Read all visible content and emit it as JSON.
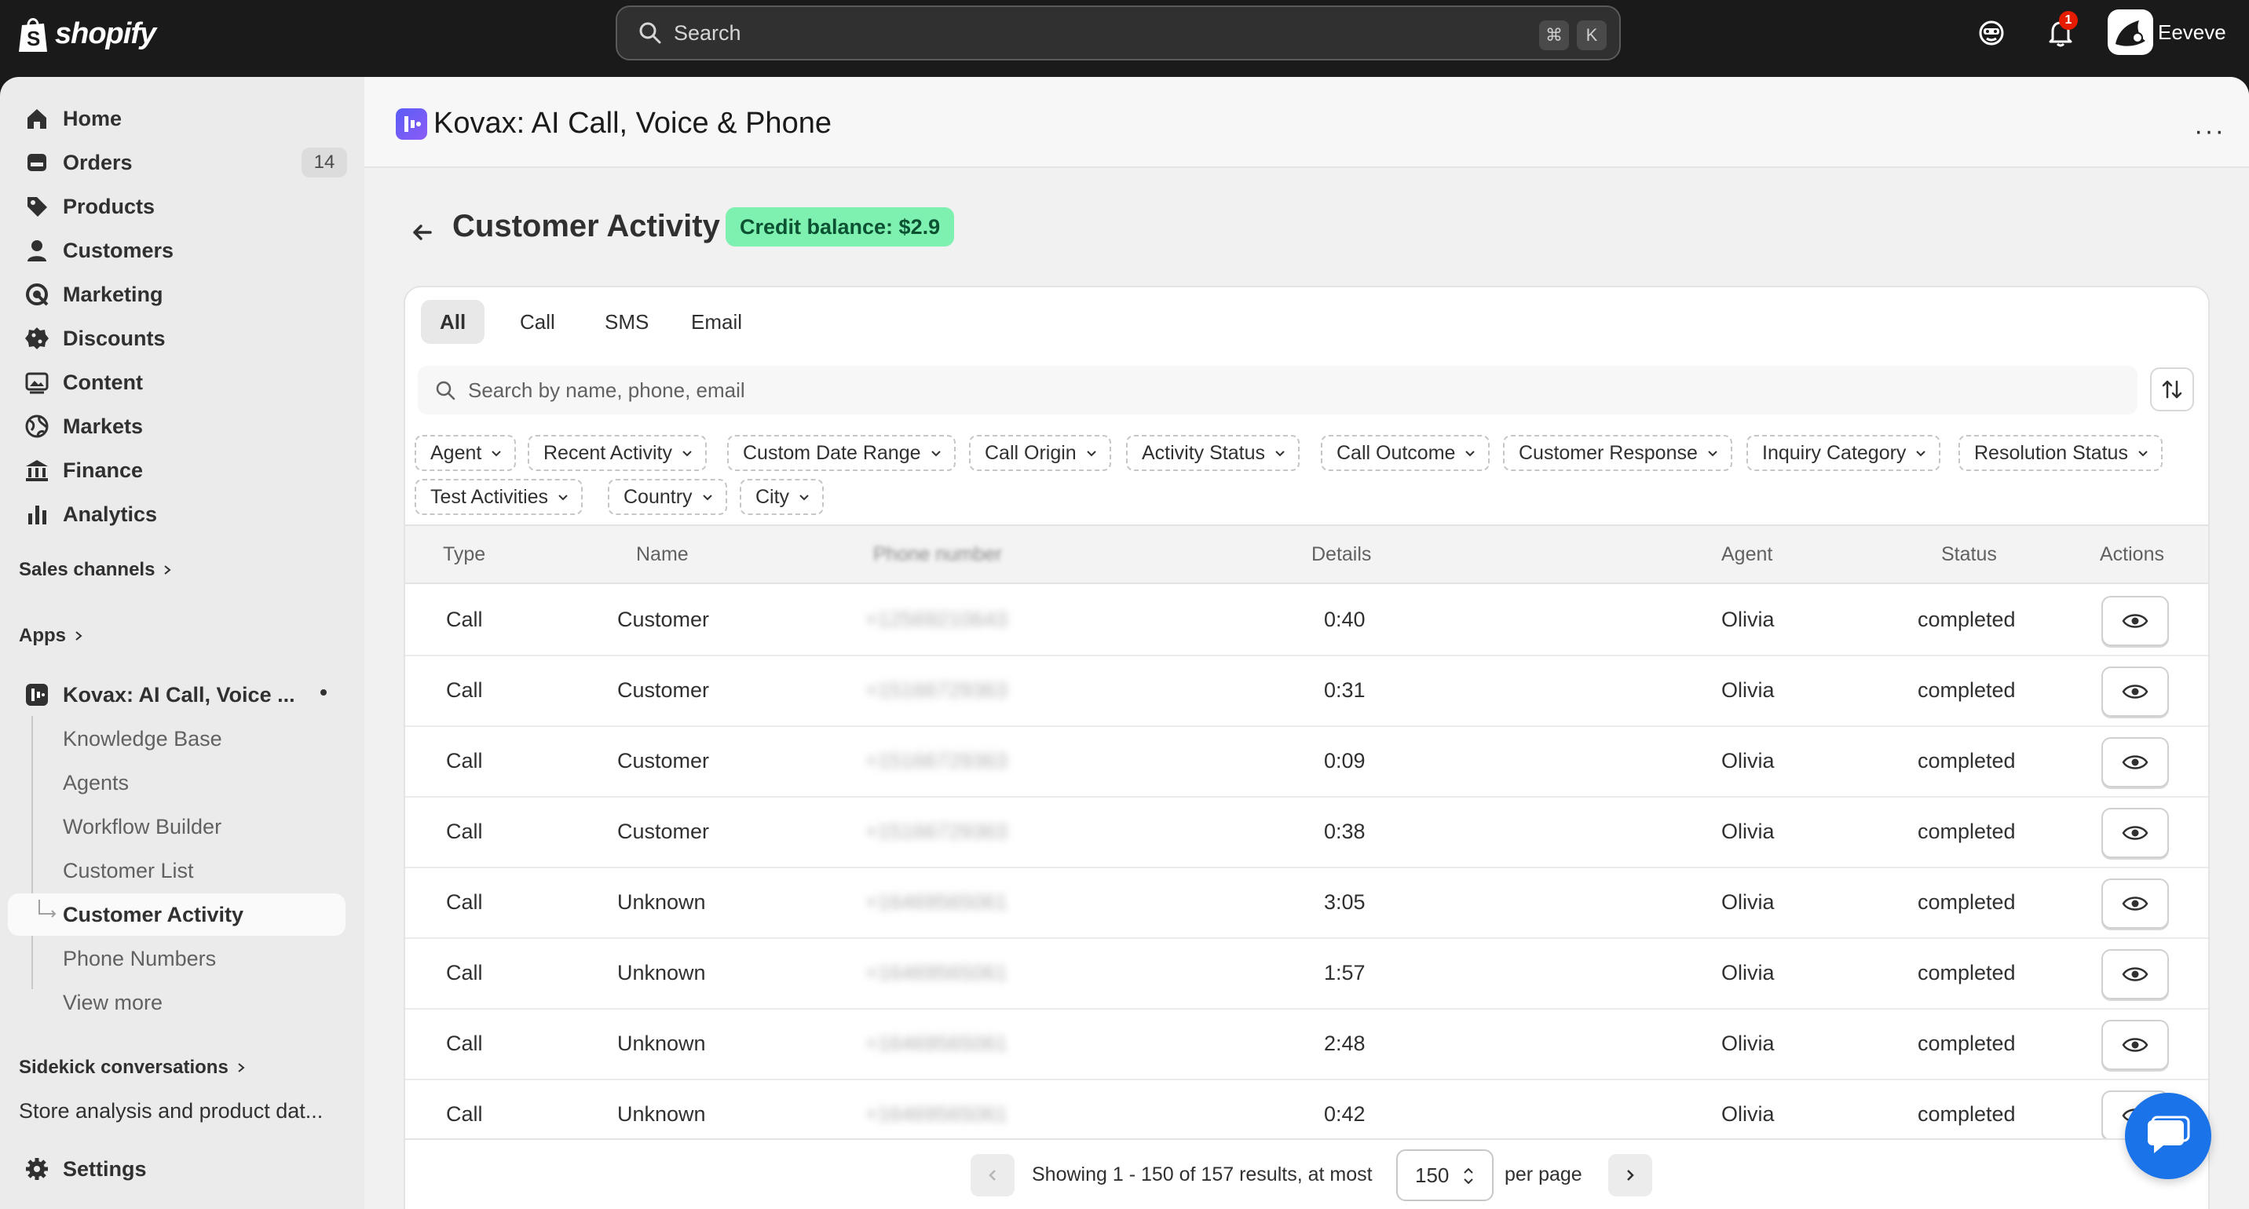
{
  "topbar": {
    "brand": "shopify",
    "search_placeholder": "Search",
    "kbd_cmd": "⌘",
    "kbd_k": "K",
    "notification_count": "1",
    "user_name": "Eeveve"
  },
  "sidebar": {
    "items": [
      {
        "label": "Home",
        "icon": "home-icon"
      },
      {
        "label": "Orders",
        "icon": "orders-icon",
        "count": "14"
      },
      {
        "label": "Products",
        "icon": "tag-icon"
      },
      {
        "label": "Customers",
        "icon": "person-icon"
      },
      {
        "label": "Marketing",
        "icon": "target-icon"
      },
      {
        "label": "Discounts",
        "icon": "discount-icon"
      },
      {
        "label": "Content",
        "icon": "image-icon"
      },
      {
        "label": "Markets",
        "icon": "globe-icon"
      },
      {
        "label": "Finance",
        "icon": "bank-icon"
      },
      {
        "label": "Analytics",
        "icon": "bar-chart-icon"
      }
    ],
    "sales_channels": "Sales channels",
    "apps": "Apps",
    "app_name": "Kovax: AI Call, Voice ...",
    "app_subitems": [
      "Knowledge Base",
      "Agents",
      "Workflow Builder",
      "Customer List",
      "Customer Activity",
      "Phone Numbers",
      "View more"
    ],
    "sidekick": "Sidekick conversations",
    "sidekick_item": "Store analysis and product dat...",
    "settings": "Settings"
  },
  "app_header": {
    "title": "Kovax: AI Call, Voice & Phone",
    "more": "···"
  },
  "page": {
    "title": "Customer Activity",
    "credit_badge": "Credit balance: $2.9"
  },
  "tabs": [
    "All",
    "Call",
    "SMS",
    "Email"
  ],
  "search_placeholder": "Search by name, phone, email",
  "filters": [
    "Agent",
    "Recent Activity",
    "Custom Date Range",
    "Call Origin",
    "Activity Status",
    "Call Outcome",
    "Customer Response",
    "Inquiry Category",
    "Resolution Status",
    "Test Activities",
    "Country",
    "City"
  ],
  "table": {
    "headers": [
      "Type",
      "Name",
      "Phone number",
      "Details",
      "Agent",
      "Status",
      "Actions"
    ],
    "rows": [
      {
        "type": "Call",
        "name": "Customer",
        "phone": "+12569210643",
        "details": "0:40",
        "agent": "Olivia",
        "status": "completed"
      },
      {
        "type": "Call",
        "name": "Customer",
        "phone": "+15166729363",
        "details": "0:31",
        "agent": "Olivia",
        "status": "completed"
      },
      {
        "type": "Call",
        "name": "Customer",
        "phone": "+15166729363",
        "details": "0:09",
        "agent": "Olivia",
        "status": "completed"
      },
      {
        "type": "Call",
        "name": "Customer",
        "phone": "+15166729363",
        "details": "0:38",
        "agent": "Olivia",
        "status": "completed"
      },
      {
        "type": "Call",
        "name": "Unknown",
        "phone": "+16469565061",
        "details": "3:05",
        "agent": "Olivia",
        "status": "completed"
      },
      {
        "type": "Call",
        "name": "Unknown",
        "phone": "+16469565061",
        "details": "1:57",
        "agent": "Olivia",
        "status": "completed"
      },
      {
        "type": "Call",
        "name": "Unknown",
        "phone": "+16469565061",
        "details": "2:48",
        "agent": "Olivia",
        "status": "completed"
      },
      {
        "type": "Call",
        "name": "Unknown",
        "phone": "+16469565061",
        "details": "0:42",
        "agent": "Olivia",
        "status": "completed"
      }
    ]
  },
  "pagination": {
    "summary": "Showing 1 - 150 of 157 results, at most",
    "per_page_value": "150",
    "per_page_label": "per page"
  },
  "colors": {
    "credit_bg": "#7ef0b0",
    "topbar_bg": "#1a1a1a",
    "chat_fab": "#1a73e8"
  }
}
